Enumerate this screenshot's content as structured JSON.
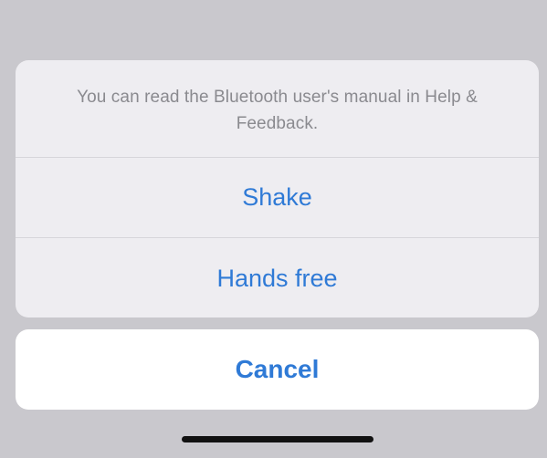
{
  "action_sheet": {
    "message": "You can read the Bluetooth user's manual in Help & Feedback.",
    "actions": [
      {
        "label": "Shake"
      },
      {
        "label": "Hands free"
      }
    ],
    "cancel_label": "Cancel"
  },
  "colors": {
    "backdrop": "#c9c8cd",
    "sheet_background": "#eeedf1",
    "action_text": "#2f7ad6",
    "message_text": "#8a8a8f",
    "cancel_background": "#ffffff",
    "home_indicator": "#111111"
  }
}
